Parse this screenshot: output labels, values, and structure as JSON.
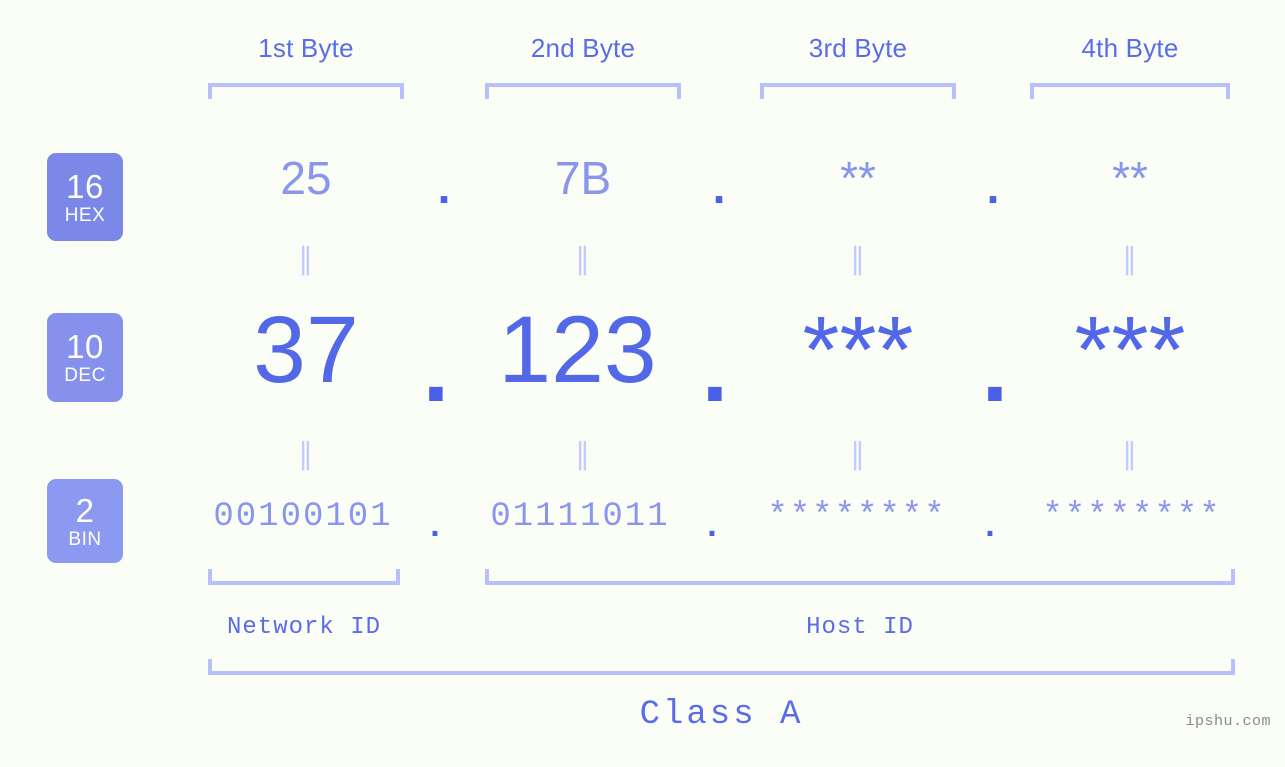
{
  "site": {
    "watermark": "ipshu.com"
  },
  "columns": [
    {
      "header": "1st Byte",
      "hex": "25",
      "dec": "37",
      "bin": "00100101"
    },
    {
      "header": "2nd Byte",
      "hex": "7B",
      "dec": "123",
      "bin": "01111011"
    },
    {
      "header": "3rd Byte",
      "hex": "**",
      "dec": "***",
      "bin": "********"
    },
    {
      "header": "4th Byte",
      "hex": "**",
      "dec": "***",
      "bin": "********"
    }
  ],
  "radix_badges": [
    {
      "number": "16",
      "abbr": "HEX",
      "color": "#7b88e8"
    },
    {
      "number": "10",
      "abbr": "DEC",
      "color": "#8591ec"
    },
    {
      "number": "2",
      "abbr": "BIN",
      "color": "#8b99f0"
    }
  ],
  "separators": {
    "dot": ".",
    "equals": "∥"
  },
  "ranges": {
    "network_id": "Network ID",
    "host_id": "Host ID",
    "class": "Class A"
  },
  "colors": {
    "background": "#fbfdf7",
    "accent_dark": "#5b6ce8",
    "accent_light": "#8a96ee",
    "bracket": "#b8c0fb",
    "separator": "#c3cbfb"
  }
}
